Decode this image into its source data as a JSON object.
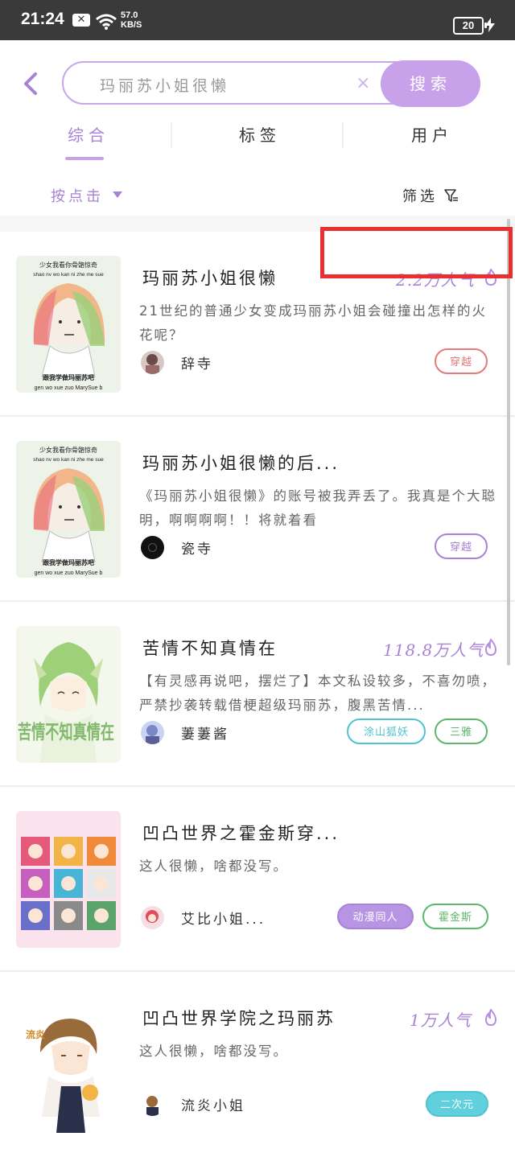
{
  "status_bar": {
    "time": "21:24",
    "speed_value": "57.0",
    "speed_unit": "KB/S",
    "battery": "20"
  },
  "search": {
    "query": "玛丽苏小姐很懒",
    "clear_symbol": "×",
    "button_label": "搜索"
  },
  "tabs": [
    {
      "label": "综合",
      "active": true
    },
    {
      "label": "标签",
      "active": false
    },
    {
      "label": "用户",
      "active": false
    }
  ],
  "sort": {
    "label": "按点击"
  },
  "filter": {
    "label": "筛选"
  },
  "results": [
    {
      "title": "玛丽苏小姐很懒",
      "popularity": "2.2万人气",
      "description": "21世纪的普通少女变成玛丽苏小姐会碰撞出怎样的火花呢？",
      "author": "辞寺",
      "tags": [
        {
          "label": "穿越",
          "color": "#e57a7a"
        }
      ],
      "cover_text_top": "少女我看你骨骼惊奇",
      "cover_text_pinyin": "shao nv wo kan ni zhe me sue",
      "cover_text_bottom": "跟我学做玛丽苏吧",
      "cover_text_pinyin2": "gen wo xue zuo MarySue b"
    },
    {
      "title": "玛丽苏小姐很懒的后...",
      "popularity": "",
      "description": "《玛丽苏小姐很懒》的账号被我弄丢了。我真是个大聪明，啊啊啊啊！！将就着看",
      "author": "瓷寺",
      "tags": [
        {
          "label": "穿越",
          "color": "#a882d6"
        }
      ],
      "cover_text_top": "少女我看你骨骼惊奇",
      "cover_text_pinyin": "shao nv wo kan ni zhe me sue",
      "cover_text_bottom": "跟我学做玛丽苏吧",
      "cover_text_pinyin2": "gen wo xue zuo MarySue b"
    },
    {
      "title": "苦情不知真情在",
      "popularity": "118.8万人气",
      "description": "【有灵感再说吧，摆烂了】本文私设较多，不喜勿喷，严禁抄袭转载借梗超级玛丽苏，腹黑苦情...",
      "author": "萋萋酱",
      "tags": [
        {
          "label": "涂山狐妖",
          "color": "#4fc3cf"
        },
        {
          "label": "三雅",
          "color": "#5bb76b"
        }
      ],
      "cover_text": "苦情不知真情在"
    },
    {
      "title": "凹凸世界之霍金斯穿...",
      "popularity": "",
      "description": "这人很懒，啥都没写。",
      "author": "艾比小姐...",
      "tags": [
        {
          "label": "动漫同人",
          "color": "#a882d6",
          "filled": true
        },
        {
          "label": "霍金斯",
          "color": "#5bb76b"
        }
      ]
    },
    {
      "title": "凹凸世界学院之玛丽苏",
      "popularity": "1万人气",
      "description": "这人很懒，啥都没写。",
      "author": "流炎小姐",
      "tags": [
        {
          "label": "二次元",
          "color": "#4fc3cf",
          "filled": true
        }
      ],
      "cover_text": "流炎"
    }
  ]
}
